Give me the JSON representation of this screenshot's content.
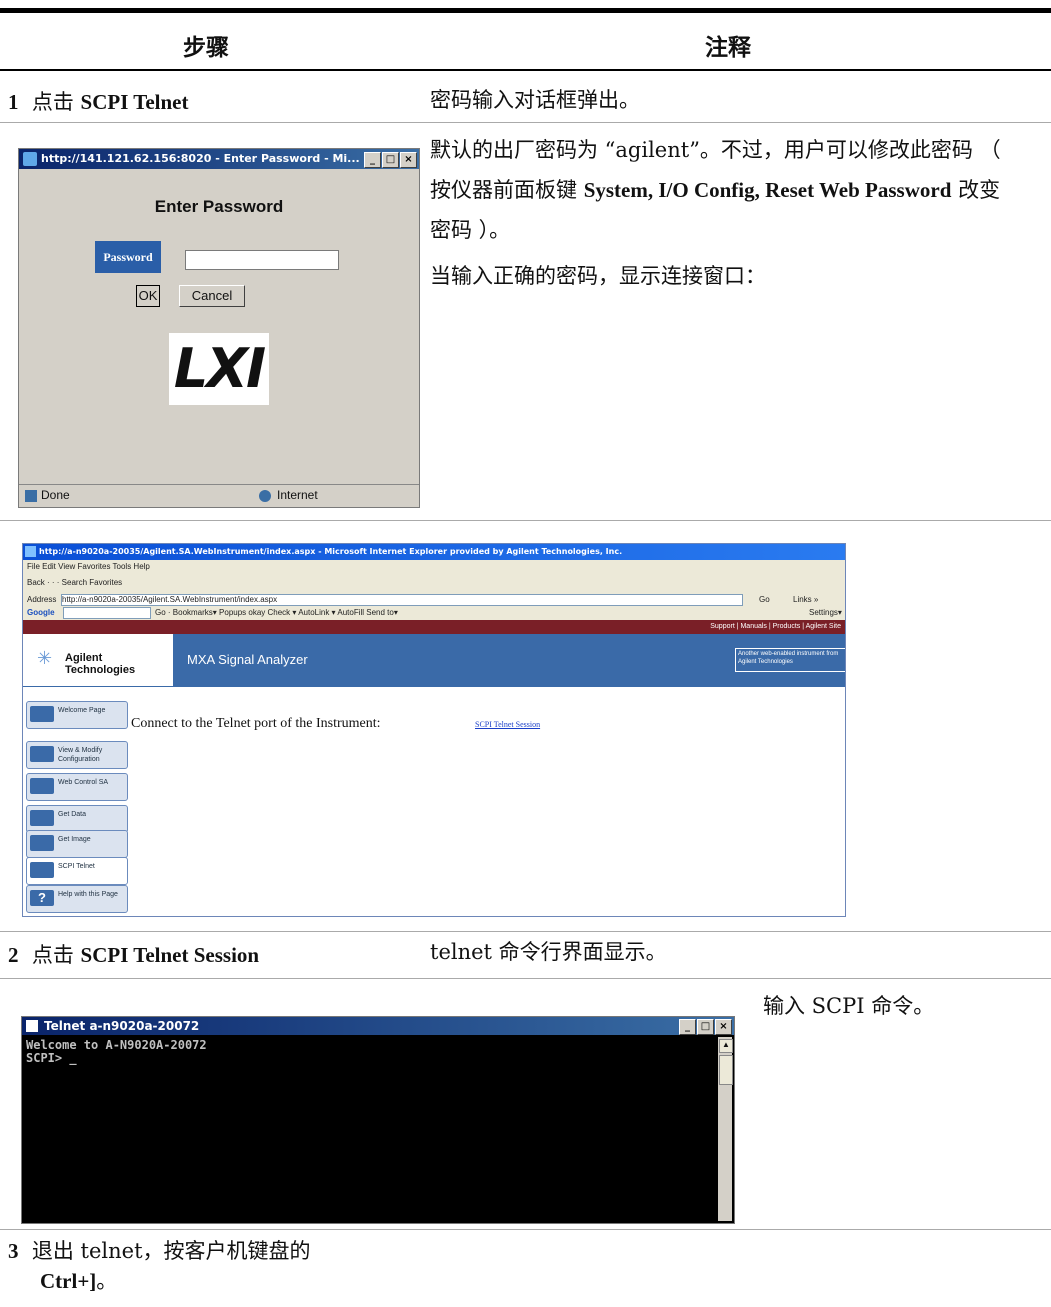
{
  "header": {
    "col_steps": "步骤",
    "col_notes": "注释"
  },
  "row1": {
    "num": "1",
    "pre": "点击 ",
    "bold": "SCPI Telnet",
    "note": "密码输入对话框弹出。"
  },
  "dialog": {
    "title": "http://141.121.62.156:8020 - Enter Password - Mi...",
    "heading": "Enter Password",
    "password_label": "Password",
    "password_value": "",
    "ok": "OK",
    "cancel": "Cancel",
    "logo": "LXI",
    "status_done": "Done",
    "status_zone": "Internet"
  },
  "notes1": {
    "p1_a": "默认的出厂密码为 “agilent”。不过，用户可以修改此密码 （ 按仪器前面板键 ",
    "p1_b": "System, I/O Config, Reset Web Password",
    "p1_c": " 改变密码 ）。",
    "p2": "当输入正确的密码，显示连接窗口："
  },
  "browser": {
    "title": "http://a-n9020a-20035/Agilent.SA.WebInstrument/index.aspx - Microsoft Internet Explorer provided by Agilent Technologies, Inc.",
    "menu": "File   Edit   View   Favorites   Tools   Help",
    "toolbar": "Back  ·  ·  ·  Search   Favorites",
    "address_label": "Address",
    "address": "http://a-n9020a-20035/Agilent.SA.WebInstrument/index.aspx",
    "go": "Go",
    "links": "Links »",
    "google": "Google",
    "google_tools": "Go  ·  Bookmarks▾  Popups okay  Check ▾  AutoLink ▾  AutoFill  Send to▾",
    "settings": "Settings▾",
    "top_links": "Support | Manuals | Products | Agilent Site",
    "brand": "Agilent Technologies",
    "product": "MXA Signal Analyzer",
    "badge": "Another web-enabled instrument from Agilent Technologies",
    "connect_text": "Connect to the Telnet port of the Instrument:",
    "connect_link": "SCPI Telnet Session",
    "nav": [
      "Welcome Page",
      "View & Modify Configuration",
      "Web Control SA",
      "Get Data",
      "Get Image",
      "SCPI Telnet",
      "Help with this Page"
    ]
  },
  "row2": {
    "num": "2",
    "pre": "点击 ",
    "bold": "SCPI Telnet Session",
    "note": "telnet 命令行界面显示。"
  },
  "telnet": {
    "title": "Telnet a-n9020a-20072",
    "line1": "Welcome to A-N9020A-20072",
    "line2": "SCPI> _",
    "note": "输入 SCPI 命令。"
  },
  "row3": {
    "num": "3",
    "line1": "退出 telnet，按客户机键盘的",
    "line2_bold": "Ctrl+]",
    "line2_end": "。"
  }
}
